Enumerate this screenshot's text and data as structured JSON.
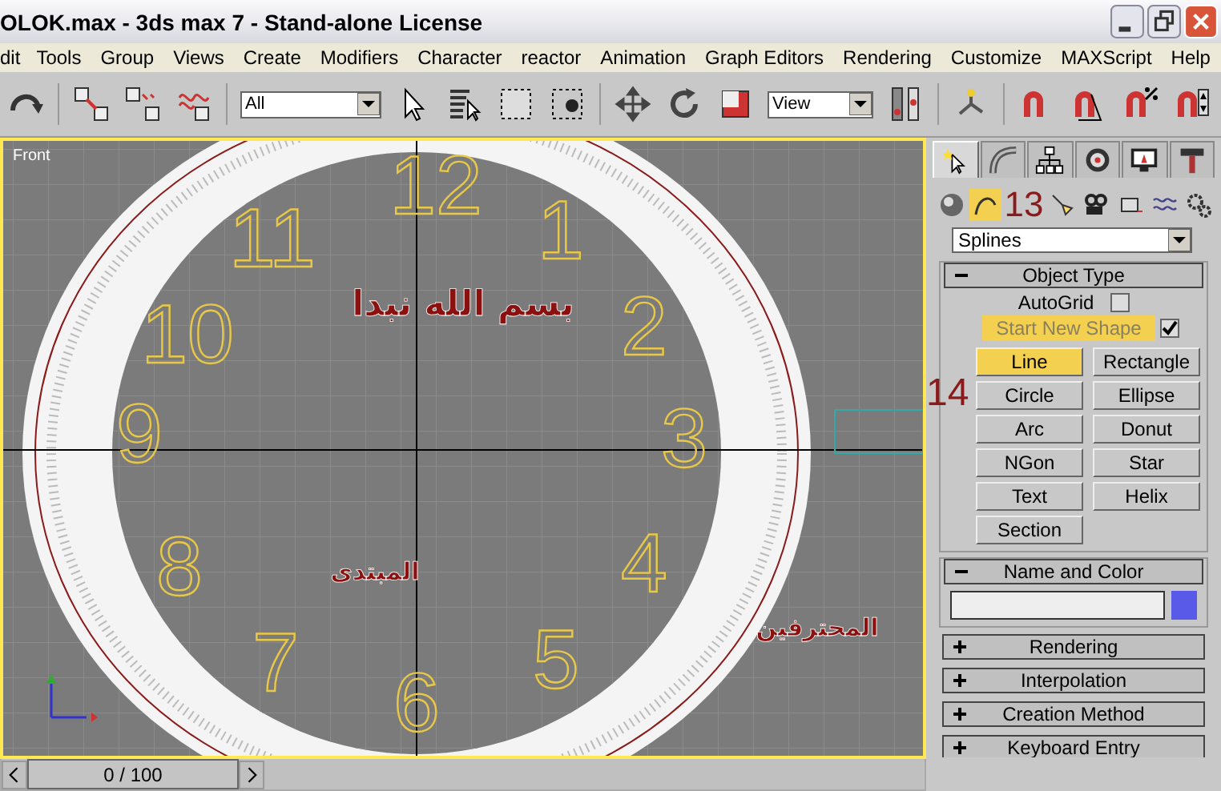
{
  "window": {
    "title": "OLOK.max - 3ds max 7  - Stand-alone License"
  },
  "menu": [
    "dit",
    "Tools",
    "Group",
    "Views",
    "Create",
    "Modifiers",
    "Character",
    "reactor",
    "Animation",
    "Graph Editors",
    "Rendering",
    "Customize",
    "MAXScript",
    "Help"
  ],
  "toolbar": {
    "selection_filter": "All",
    "reference_coordinates": "View"
  },
  "viewport": {
    "label": "Front",
    "clock_numbers": [
      "12",
      "1",
      "2",
      "3",
      "4",
      "5",
      "6",
      "7",
      "8",
      "9",
      "10",
      "11"
    ],
    "captions": [
      {
        "text": "بسم الله نبدا"
      },
      {
        "text": "المبتدى"
      },
      {
        "text": "المحترفين"
      }
    ]
  },
  "annotations": [
    "13",
    "14"
  ],
  "command_panel": {
    "tabs": [
      {
        "kind": "create",
        "selected": true
      },
      {
        "kind": "modify",
        "selected": false
      },
      {
        "kind": "hierarchy",
        "selected": false
      },
      {
        "kind": "motion",
        "selected": false
      },
      {
        "kind": "display",
        "selected": false
      },
      {
        "kind": "utilities",
        "selected": false
      }
    ],
    "categories": [
      {
        "kind": "geometry",
        "selected": false
      },
      {
        "kind": "shapes",
        "selected": true
      },
      {
        "kind": "lights",
        "selected": false
      },
      {
        "kind": "cameras",
        "selected": false
      },
      {
        "kind": "helpers",
        "selected": false
      },
      {
        "kind": "spacewarps",
        "selected": false
      },
      {
        "kind": "systems",
        "selected": false
      }
    ],
    "subcategory": "Splines",
    "object_type": {
      "title": "Object Type",
      "expanded": true,
      "autogrid": {
        "label": "AutoGrid",
        "checked": false
      },
      "start_new_shape": {
        "label": "Start New Shape",
        "checked": true
      },
      "buttons": [
        {
          "label": "Line",
          "selected": true
        },
        {
          "label": "Rectangle",
          "selected": false
        },
        {
          "label": "Circle",
          "selected": false
        },
        {
          "label": "Ellipse",
          "selected": false
        },
        {
          "label": "Arc",
          "selected": false
        },
        {
          "label": "Donut",
          "selected": false
        },
        {
          "label": "NGon",
          "selected": false
        },
        {
          "label": "Star",
          "selected": false
        },
        {
          "label": "Text",
          "selected": false
        },
        {
          "label": "Helix",
          "selected": false
        },
        {
          "label": "Section",
          "selected": false
        }
      ]
    },
    "name_and_color": {
      "title": "Name and Color",
      "expanded": true,
      "color": "#5a5ae8"
    },
    "rollouts": [
      {
        "title": "Rendering",
        "expanded": false
      },
      {
        "title": "Interpolation",
        "expanded": false
      },
      {
        "title": "Creation Method",
        "expanded": false
      },
      {
        "title": "Keyboard Entry",
        "expanded": false
      }
    ]
  },
  "timeline": {
    "frame": "0 / 100"
  }
}
